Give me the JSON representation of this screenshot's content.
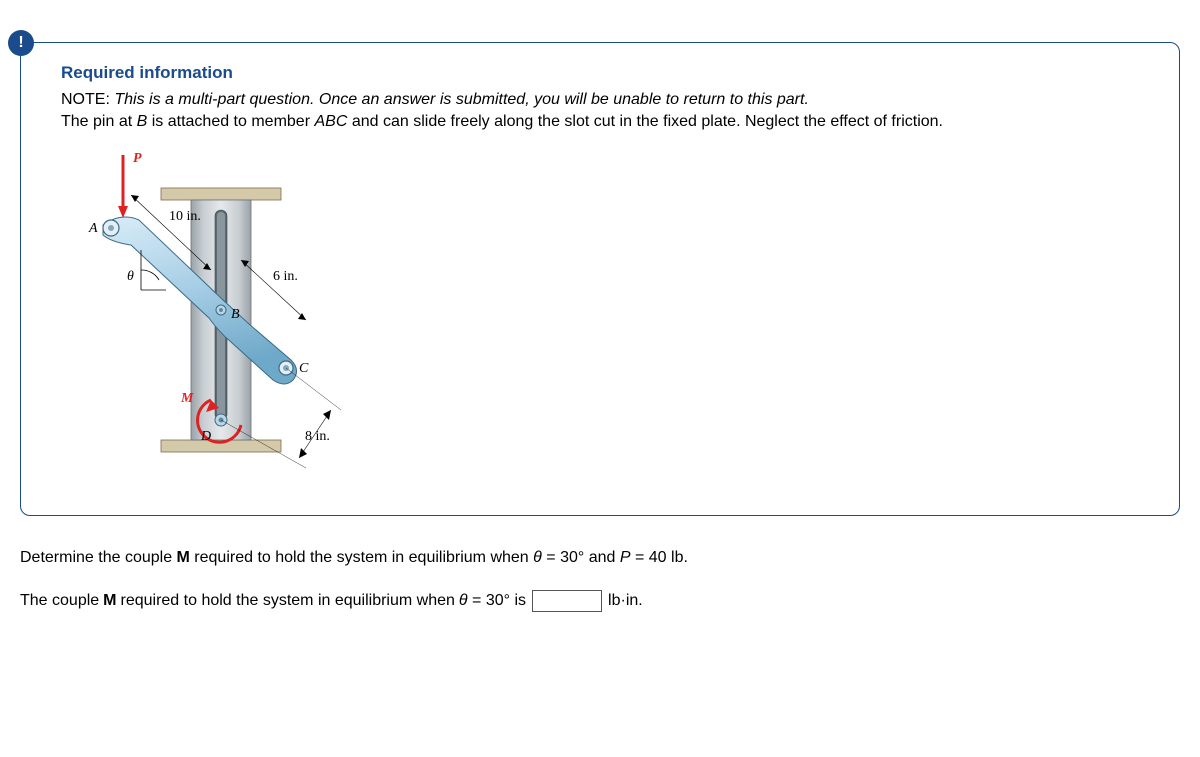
{
  "box": {
    "heading": "Required information",
    "note_label": "NOTE: ",
    "note_italic": "This is a multi-part question. Once an answer is submitted, you will be unable to return to this part.",
    "desc_pre": "The pin at ",
    "desc_B": "B",
    "desc_mid": " is attached to member ",
    "desc_ABC": "ABC",
    "desc_post": " and can slide freely along the slot cut in the fixed plate. Neglect the effect of friction."
  },
  "diagram": {
    "label_P": "P",
    "label_A": "A",
    "label_B": "B",
    "label_C": "C",
    "label_D": "D",
    "label_M": "M",
    "label_theta": "θ",
    "dim_10": "10 in.",
    "dim_6": "6 in.",
    "dim_8": "8 in."
  },
  "question": {
    "q_pre": "Determine the couple ",
    "q_M": "M",
    "q_mid": " required to hold the system in equilibrium when ",
    "q_theta": "θ",
    "q_eq30": " = 30° and ",
    "q_P": "P",
    "q_eq40": " = 40 lb."
  },
  "answer": {
    "a_pre": "The couple ",
    "a_M": "M",
    "a_mid": " required to hold the system in equilibrium when ",
    "a_theta": "θ",
    "a_eq30": " = 30° is ",
    "a_unit": " lb·in."
  }
}
